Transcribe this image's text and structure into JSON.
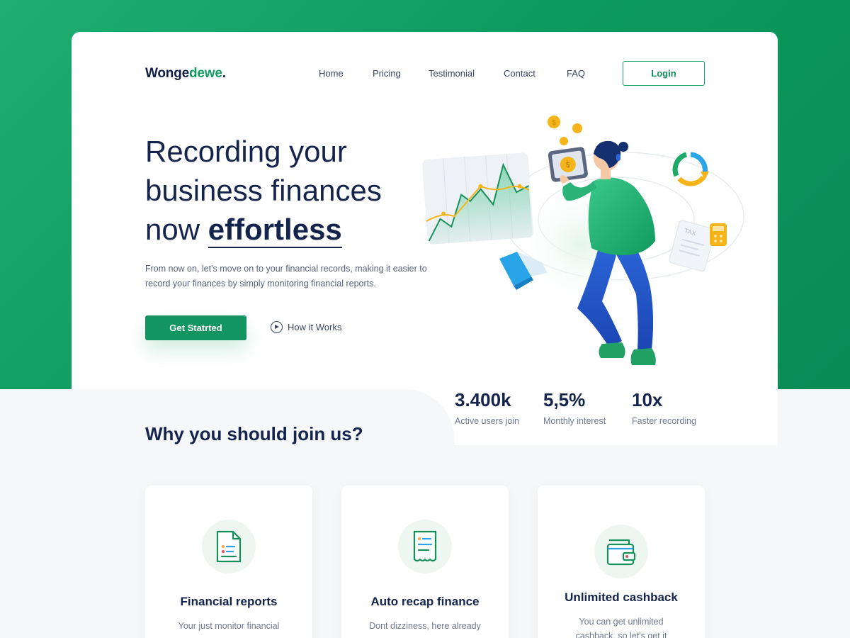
{
  "brand": {
    "part1": "Wonge",
    "part2": "dewe",
    "dot": "."
  },
  "nav": {
    "items": [
      "Home",
      "Pricing",
      "Testimonial",
      "Contact",
      "FAQ"
    ],
    "login": "Login"
  },
  "hero": {
    "title_line1": "Recording your",
    "title_line2": "business finances",
    "title_line3_prefix": "now ",
    "title_emphasis": "effortless",
    "description": "From now on, let's move on to your financial records, making it easier to record your finances by simply monitoring financial reports.",
    "cta_primary": "Get Statrted",
    "cta_secondary": "How it Works"
  },
  "stats": [
    {
      "value": "3.400k",
      "label": "Active users join"
    },
    {
      "value": "5,5%",
      "label": "Monthly interest"
    },
    {
      "value": "10x",
      "label": "Faster recording"
    }
  ],
  "why": {
    "heading": "Why you should join us?",
    "features": [
      {
        "title": "Financial reports",
        "desc": "Your just monitor financial",
        "icon": "document-icon"
      },
      {
        "title": "Auto recap finance",
        "desc": "Dont dizziness, here already",
        "icon": "receipt-icon"
      },
      {
        "title": "Unlimited cashback",
        "desc": "You can get unlimited cashback, so let's get it",
        "icon": "wallet-icon"
      }
    ]
  },
  "colors": {
    "brand_green": "#129560",
    "navy": "#14244c",
    "accent_yellow": "#f5b51a"
  },
  "illustration": {
    "tax_tag": "TAX",
    "coin_symbol": "$"
  }
}
